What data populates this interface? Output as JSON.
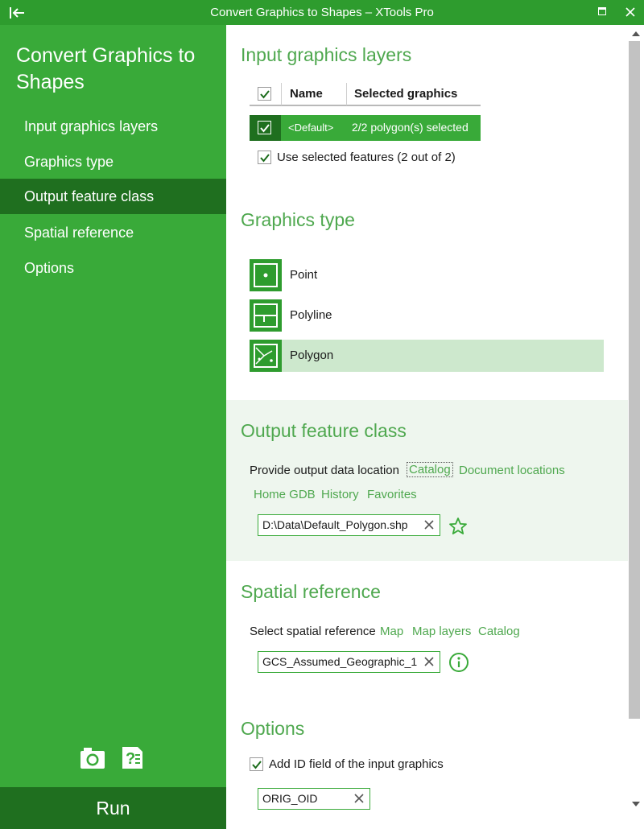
{
  "window": {
    "title": "Convert Graphics to Shapes – XTools Pro"
  },
  "sidebar": {
    "heading": "Convert Graphics to Shapes",
    "items": [
      {
        "label": "Input graphics layers"
      },
      {
        "label": "Graphics type"
      },
      {
        "label": "Output feature class"
      },
      {
        "label": "Spatial reference"
      },
      {
        "label": "Options"
      }
    ],
    "active_item": "Output feature class",
    "run_label": "Run"
  },
  "input_layers": {
    "title": "Input graphics layers",
    "columns": [
      "Name",
      "Selected graphics"
    ],
    "rows": [
      {
        "name": "<Default>",
        "selected": "2/2 polygon(s) selected",
        "checked": true
      }
    ],
    "use_selected_label": "Use selected features (2 out of 2)",
    "use_selected_checked": true
  },
  "graphics_type": {
    "title": "Graphics type",
    "options": [
      {
        "label": "Point",
        "icon": "point-icon"
      },
      {
        "label": "Polyline",
        "icon": "polyline-icon"
      },
      {
        "label": "Polygon",
        "icon": "polygon-icon"
      }
    ],
    "selected": "Polygon"
  },
  "output": {
    "title": "Output feature class",
    "prompt": "Provide output data location",
    "links": [
      "Catalog",
      "Document locations",
      "Home GDB",
      "History",
      "Favorites"
    ],
    "path_value": "D:\\Data\\Default_Polygon.shp"
  },
  "spatial": {
    "title": "Spatial reference",
    "prompt": "Select spatial reference",
    "links": [
      "Map",
      "Map layers",
      "Catalog"
    ],
    "value": "GCS_Assumed_Geographic_1"
  },
  "options": {
    "title": "Options",
    "add_id_label": "Add ID field of the input graphics",
    "add_id_checked": true,
    "field_value": "ORIG_OID"
  },
  "colors": {
    "sidebar": "#39aa39",
    "sidebar_active": "#1f6f1f",
    "titlebar": "#2e9c2e",
    "accent": "#4fa84f",
    "band": "#eef6ee",
    "selected_row": "#cde8cd"
  }
}
